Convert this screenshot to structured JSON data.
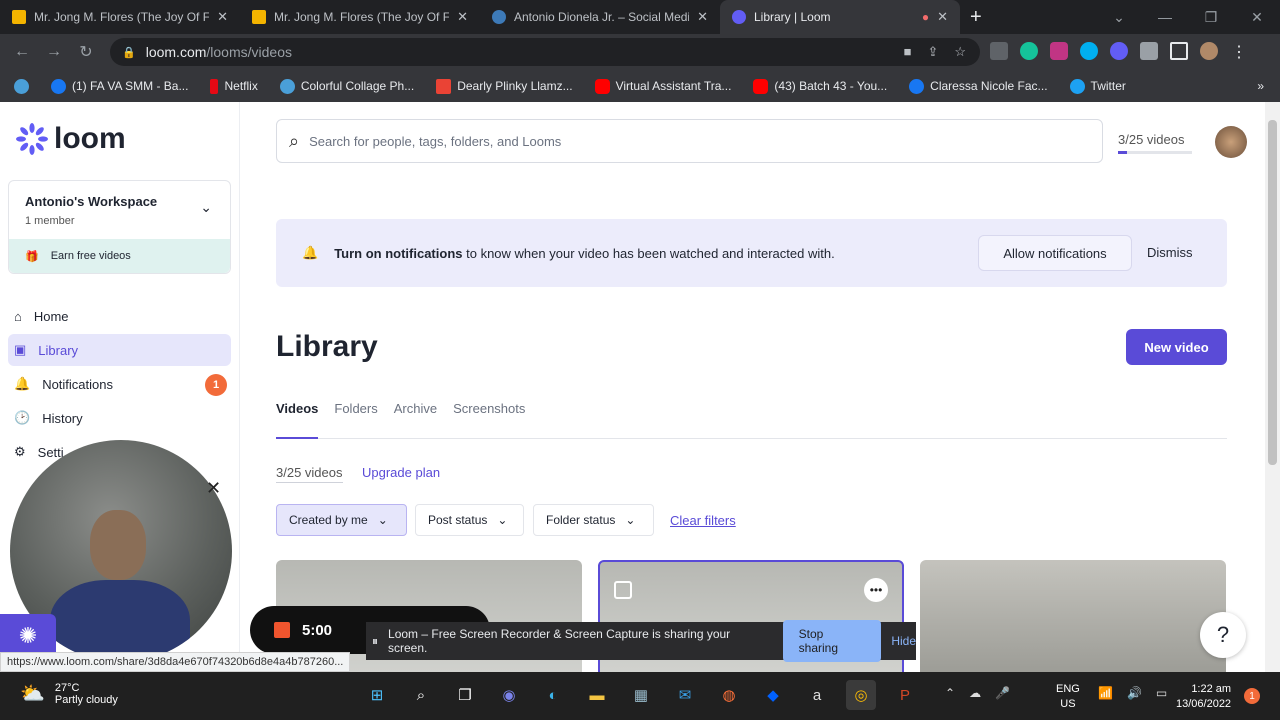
{
  "browser": {
    "tabs": [
      {
        "title": "Mr. Jong M. Flores (The Joy Of Fa",
        "active": false,
        "favicon_color": "#f4b400"
      },
      {
        "title": "Mr. Jong M. Flores (The Joy Of Fa",
        "active": false,
        "favicon_color": "#f4b400"
      },
      {
        "title": "Antonio Dionela Jr. – Social Medi",
        "active": false,
        "favicon_color": "#3d7ab8"
      },
      {
        "title": "Library | Loom",
        "active": true,
        "favicon_color": "#625df5"
      }
    ],
    "url_host": "loom.com",
    "url_path": "/looms/videos",
    "bookmarks": [
      "(1) FA VA SMM - Ba...",
      "Netflix",
      "Colorful Collage Ph...",
      "Dearly Plinky Llamz...",
      "Virtual Assistant Tra...",
      "(43) Batch 43 - You...",
      "Claressa Nicole Fac...",
      "Twitter"
    ]
  },
  "sidebar": {
    "logo": "loom",
    "workspace_name": "Antonio's Workspace",
    "workspace_members": "1 member",
    "earn": "Earn free videos",
    "nav": [
      {
        "label": "Home",
        "icon": "home-icon"
      },
      {
        "label": "Library",
        "icon": "library-icon",
        "selected": true
      },
      {
        "label": "Notifications",
        "icon": "bell-icon",
        "badge": "1"
      },
      {
        "label": "History",
        "icon": "clock-icon"
      },
      {
        "label": "Setti",
        "icon": "gear-icon"
      }
    ]
  },
  "header": {
    "search_placeholder": "Search for people, tags, folders, and Looms",
    "video_count": "3/25 videos",
    "video_quota_fraction": 0.12
  },
  "notice": {
    "bold": "Turn on notifications",
    "text": "to know when your video has been watched and interacted with.",
    "allow": "Allow notifications",
    "dismiss": "Dismiss"
  },
  "library": {
    "title": "Library",
    "new_video": "New video",
    "tabs": [
      "Videos",
      "Folders",
      "Archive",
      "Screenshots"
    ],
    "count": "3/25 videos",
    "upgrade": "Upgrade plan",
    "filters": [
      "Created by me",
      "Post status",
      "Folder status"
    ],
    "clear": "Clear filters"
  },
  "recording": {
    "timer": "5:00",
    "share_text": "Loom – Free Screen Recorder & Screen Capture is sharing your screen.",
    "stop_sharing": "Stop sharing",
    "hide": "Hide"
  },
  "status_url": "https://www.loom.com/share/3d8da4e670f74320b6d8e4a4b787260...",
  "help": "?",
  "taskbar": {
    "temp": "27°C",
    "weather": "Partly cloudy",
    "lang1": "ENG",
    "lang2": "US",
    "time": "1:22 am",
    "date": "13/06/2022",
    "notif": "1"
  },
  "colors": {
    "accent": "#5a4bd7",
    "badge": "#f26b3a"
  }
}
